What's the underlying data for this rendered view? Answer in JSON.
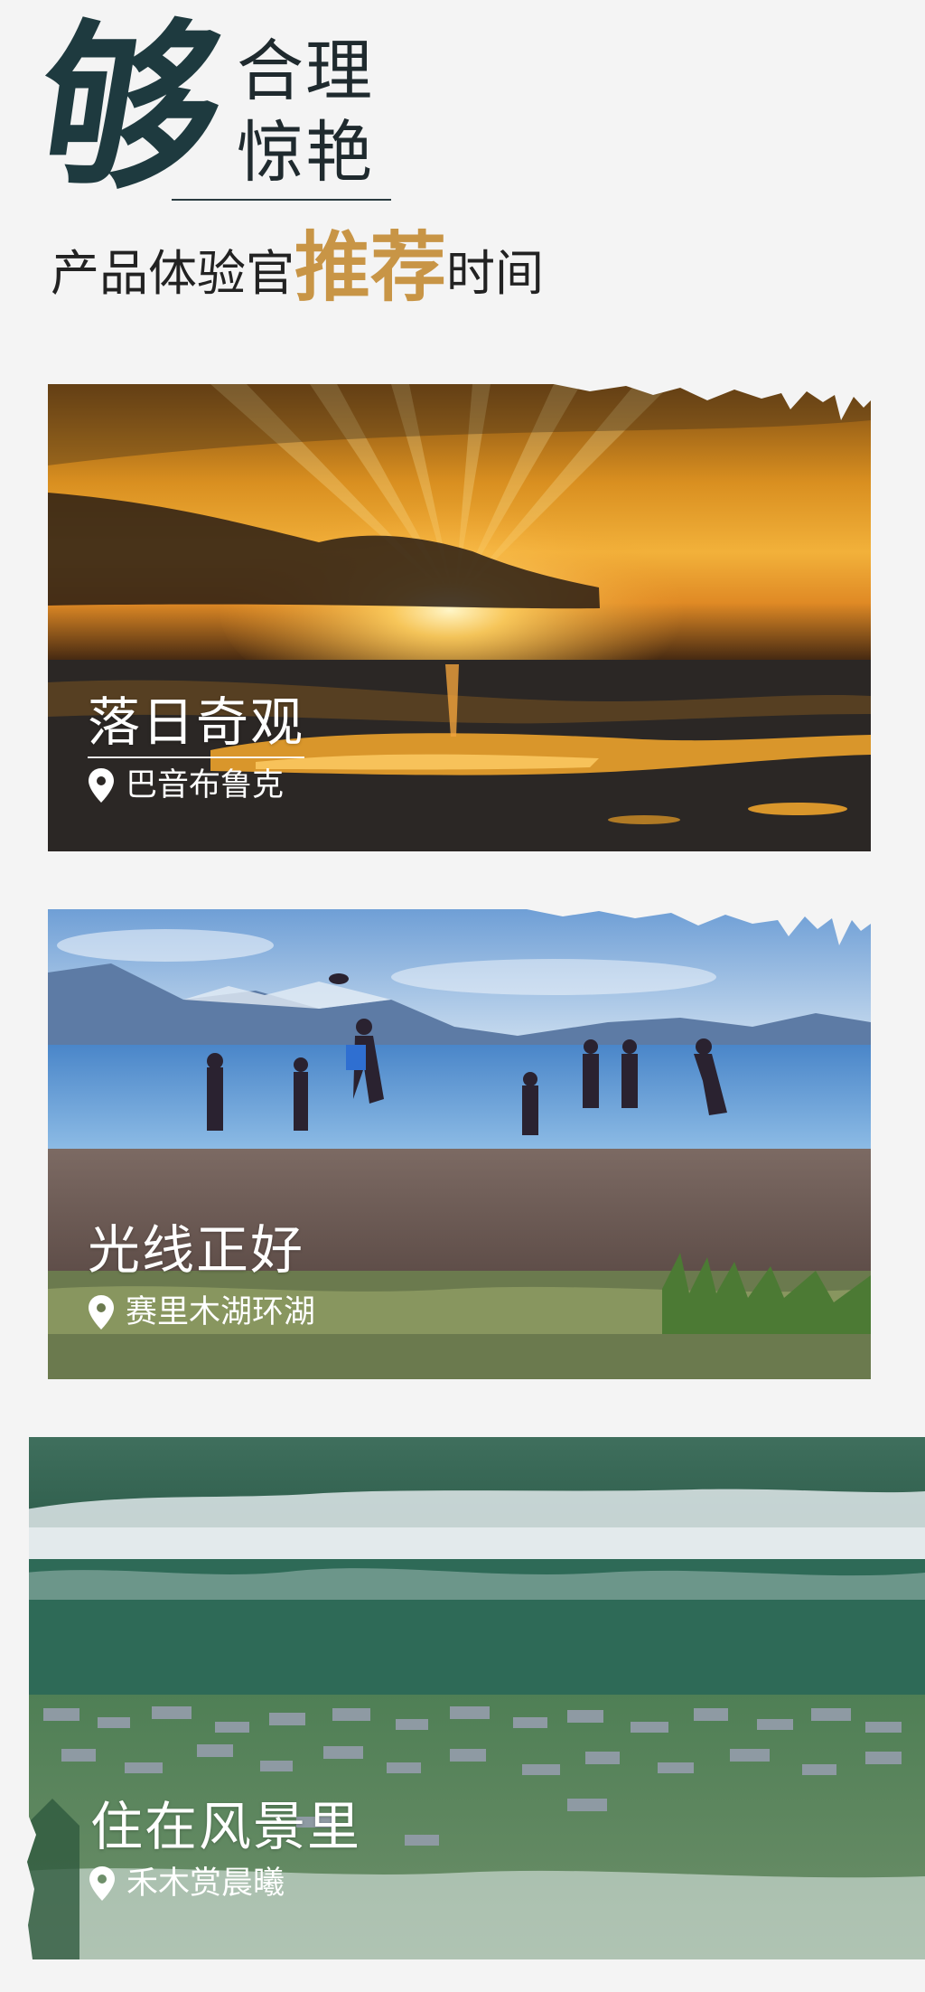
{
  "header": {
    "big_char": "够",
    "line1": "合理",
    "line2": "惊艳",
    "tagline_prefix": "产品体验官",
    "tagline_highlight": "推荐",
    "tagline_suffix": "时间"
  },
  "cards": [
    {
      "title": "落日奇观",
      "location": "巴音布鲁克"
    },
    {
      "title": "光线正好",
      "location": "赛里木湖环湖"
    },
    {
      "title": "住在风景里",
      "location": "禾木赏晨曦"
    }
  ],
  "colors": {
    "background": "#f4f4f4",
    "dark_teal": "#1e3a3f",
    "accent_gold": "#c89546",
    "text_white": "#ffffff"
  },
  "icons": {
    "location": "map-pin-icon"
  }
}
